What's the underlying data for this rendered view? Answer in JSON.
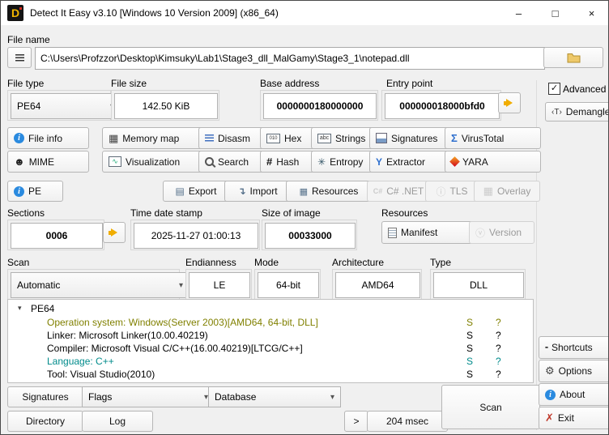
{
  "window": {
    "title": "Detect It Easy v3.10 [Windows 10 Version 2009] (x86_64)"
  },
  "icons": {
    "logo_letter": "D",
    "minimize": "–",
    "maximize": "□",
    "close": "×",
    "combo_arrow": "▾",
    "tree_arrow": "▾",
    "info_letter": "i",
    "memory_map": "▦",
    "hex": "010",
    "strings": "abc",
    "virustotal": "Σ",
    "mime": "☻",
    "visualization": "∿",
    "hash": "#",
    "entropy": "✳",
    "extractor": "Y",
    "dotnet": "C#",
    "tls": "ⓘ",
    "overlay": "▦",
    "export": "▤",
    "import": "↴",
    "resources": "▦",
    "version": "ⓥ",
    "shortcuts": "▪▪",
    "options": "⚙",
    "exit": "✗",
    "check": "✓",
    "demangle": "‹T›"
  },
  "colors": {
    "accent_blue": "#2a8adf",
    "olive": "#808000",
    "teal": "#008b8b",
    "yellow_arrow": "#f0ad00",
    "exit_red": "#c0392b"
  },
  "file": {
    "label": "File name",
    "path": "C:\\Users\\Profzzor\\Desktop\\Kimsuky\\Lab1\\Stage3_dll_MalGamy\\Stage3_1\\notepad.dll"
  },
  "fields": {
    "file_type": {
      "label": "File type",
      "value": "PE64"
    },
    "file_size": {
      "label": "File size",
      "value": "142.50 KiB"
    },
    "base_address": {
      "label": "Base address",
      "value": "0000000180000000"
    },
    "entry_point": {
      "label": "Entry point",
      "value": "000000018000bfd0"
    },
    "sections": {
      "label": "Sections",
      "value": "0006"
    },
    "time_date_stamp": {
      "label": "Time date stamp",
      "value": "2025-11-27 01:00:13"
    },
    "size_of_image": {
      "label": "Size of image",
      "value": "00033000"
    },
    "resources": {
      "label": "Resources",
      "manifest": "Manifest",
      "version": "Version"
    },
    "scan": {
      "label": "Scan",
      "value": "Automatic"
    },
    "endianness": {
      "label": "Endianness",
      "value": "LE"
    },
    "mode": {
      "label": "Mode",
      "value": "64-bit"
    },
    "architecture": {
      "label": "Architecture",
      "value": "AMD64"
    },
    "type": {
      "label": "Type",
      "value": "DLL"
    }
  },
  "tools": {
    "row1": [
      "File info",
      "Memory map",
      "Disasm",
      "Hex",
      "Strings",
      "Signatures",
      "VirusTotal"
    ],
    "row2": [
      "MIME",
      "Visualization",
      "Search",
      "Hash",
      "Entropy",
      "Extractor",
      "YARA"
    ]
  },
  "pe": {
    "pe": "PE",
    "export": "Export",
    "import": "Import",
    "resources": "Resources",
    "dotnet": "C# .NET",
    "tls": "TLS",
    "overlay": "Overlay"
  },
  "right_panel": {
    "advanced": "Advanced",
    "demangle": "Demangle",
    "shortcuts": "Shortcuts",
    "options": "Options",
    "about": "About",
    "exit": "Exit"
  },
  "results": {
    "root": "PE64",
    "rows": [
      {
        "text": "Operation system: Windows(Server 2003)[AMD64, 64-bit, DLL]",
        "s": "S",
        "q": "?",
        "color": "#808000"
      },
      {
        "text": "Linker: Microsoft Linker(10.00.40219)",
        "s": "S",
        "q": "?",
        "color": "#000000"
      },
      {
        "text": "Compiler: Microsoft Visual C/C++(16.00.40219)[LTCG/C++]",
        "s": "S",
        "q": "?",
        "color": "#000000"
      },
      {
        "text": "Language: C++",
        "s": "S",
        "q": "?",
        "color": "#008b8b"
      },
      {
        "text": "Tool: Visual Studio(2010)",
        "s": "S",
        "q": "?",
        "color": "#000000"
      }
    ]
  },
  "bottom": {
    "signatures": "Signatures",
    "flags": "Flags",
    "database": "Database",
    "directory": "Directory",
    "log": "Log",
    "more": ">",
    "elapsed": "204 msec",
    "scan": "Scan"
  }
}
